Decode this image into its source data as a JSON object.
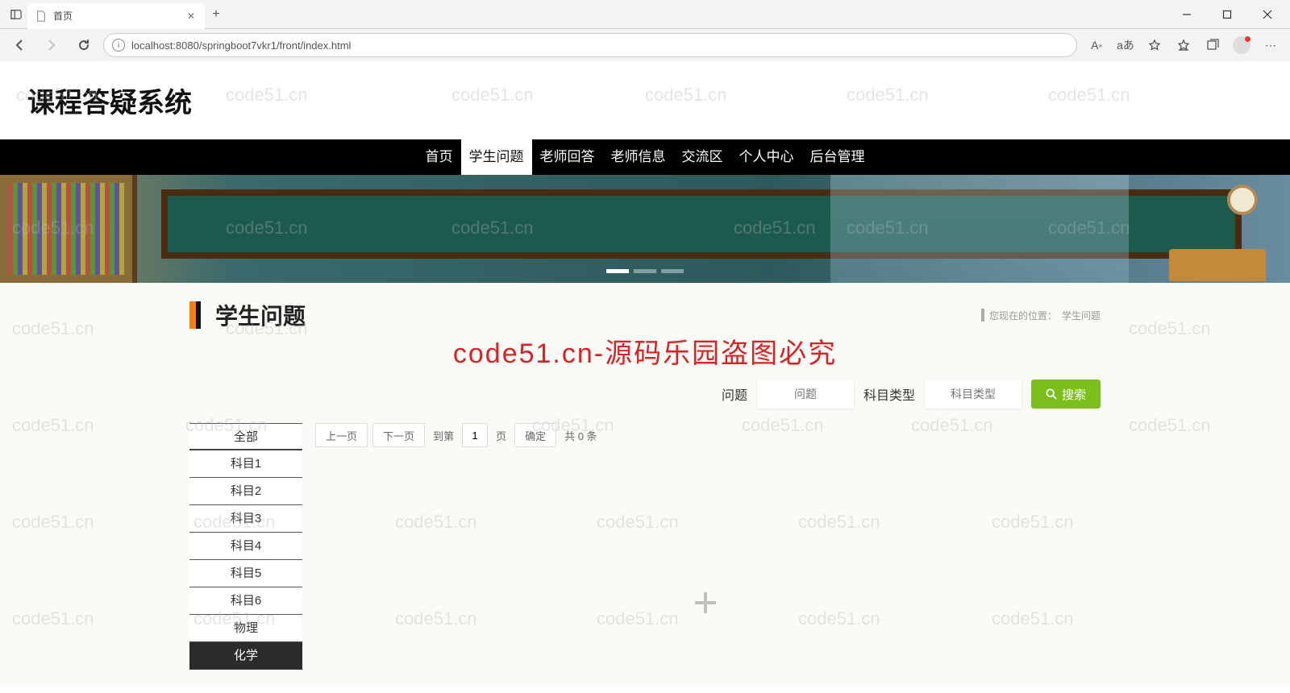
{
  "browser": {
    "tab_title": "首页",
    "url": "localhost:8080/springboot7vkr1/front/index.html"
  },
  "site_title": "课程答疑系统",
  "nav_items": [
    "首页",
    "学生问题",
    "老师回答",
    "老师信息",
    "交流区",
    "个人中心",
    "后台管理"
  ],
  "nav_active_index": 1,
  "section_title": "学生问题",
  "breadcrumb_label": "您现在的位置：",
  "breadcrumb_current": "学生问题",
  "watermark_red": "code51.cn-源码乐园盗图必究",
  "watermark_text": "code51.cn",
  "search": {
    "label_question": "问题",
    "placeholder_question": "问题",
    "label_type": "科目类型",
    "placeholder_type": "科目类型",
    "button": "搜索"
  },
  "sidebar_items": [
    "全部",
    "科目1",
    "科目2",
    "科目3",
    "科目4",
    "科目5",
    "科目6",
    "物理",
    "化学"
  ],
  "sidebar_dark_index": 8,
  "pager": {
    "prev": "上一页",
    "next": "下一页",
    "goto": "到第",
    "page_value": "1",
    "page_label": "页",
    "confirm": "确定",
    "total": "共 0 条"
  }
}
